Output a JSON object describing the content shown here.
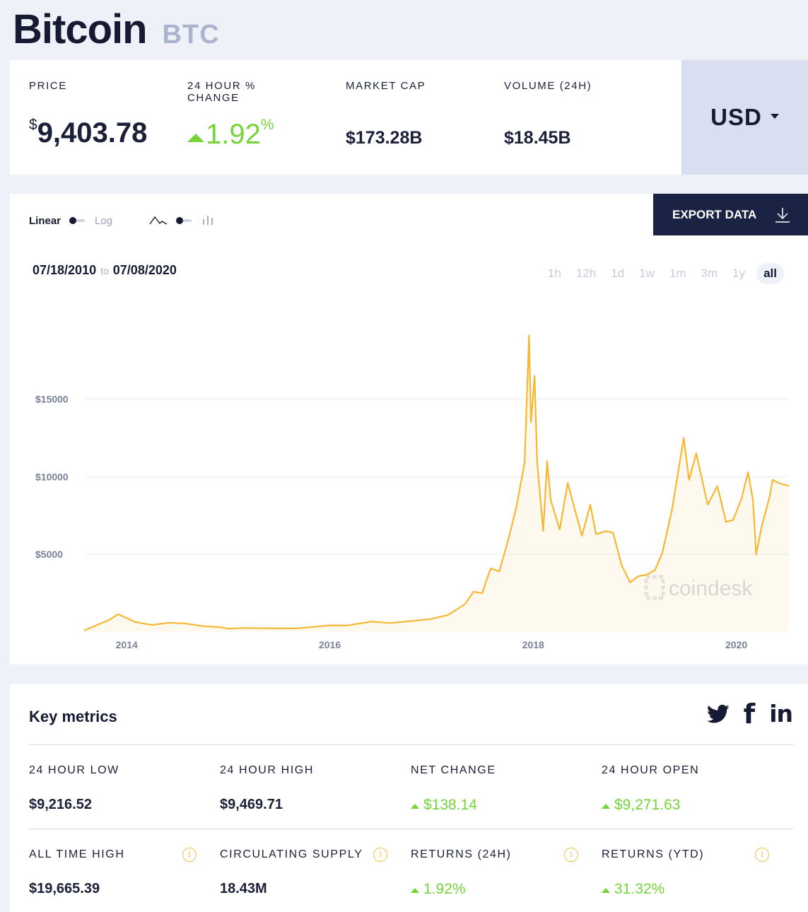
{
  "header": {
    "name": "Bitcoin",
    "symbol": "BTC"
  },
  "stats": {
    "price": {
      "label": "PRICE",
      "currency_symbol": "$",
      "value": "9,403.78"
    },
    "change": {
      "label_line1": "24 HOUR %",
      "label_line2": "CHANGE",
      "value": "1.92",
      "unit": "%",
      "direction": "up"
    },
    "market_cap": {
      "label": "MARKET CAP",
      "value": "$173.28B"
    },
    "volume": {
      "label": "VOLUME (24H)",
      "value": "$18.45B"
    },
    "currency": "USD"
  },
  "chart_controls": {
    "scale_left": "Linear",
    "scale_right": "Log",
    "line_icon": "line-chart-icon",
    "bar_icon": "candlestick-icon",
    "export_label": "EXPORT DATA",
    "date_from": "07/18/2010",
    "date_to_word": "to",
    "date_to": "07/08/2020",
    "ranges": [
      "1h",
      "12h",
      "1d",
      "1w",
      "1m",
      "3m",
      "1y",
      "all"
    ],
    "active_range": "all",
    "watermark": "coindesk"
  },
  "chart_data": {
    "type": "area",
    "xlabel": "",
    "ylabel": "",
    "x_ticks": [
      "2014",
      "2016",
      "2018",
      "2020"
    ],
    "y_ticks": [
      "$5000",
      "$10000",
      "$15000"
    ],
    "ylim": [
      0,
      19800
    ],
    "grid": true,
    "color": "#f7b731",
    "x": [
      "2013-08",
      "2013-11",
      "2013-12",
      "2014-02",
      "2014-04",
      "2014-06",
      "2014-08",
      "2014-10",
      "2014-12",
      "2015-01",
      "2015-03",
      "2015-06",
      "2015-09",
      "2015-11",
      "2016-01",
      "2016-03",
      "2016-06",
      "2016-08",
      "2016-11",
      "2017-01",
      "2017-03",
      "2017-05",
      "2017-06",
      "2017-07",
      "2017-08",
      "2017-09",
      "2017-10",
      "2017-11",
      "2017-12-01",
      "2017-12-17",
      "2017-12-24",
      "2018-01-06",
      "2018-01-15",
      "2018-02-06",
      "2018-02-20",
      "2018-03-05",
      "2018-04-06",
      "2018-05-05",
      "2018-06-25",
      "2018-07-25",
      "2018-08-15",
      "2018-09-20",
      "2018-10-15",
      "2018-11-15",
      "2018-12-15",
      "2019-01-15",
      "2019-02-15",
      "2019-03-15",
      "2019-04-10",
      "2019-05-15",
      "2019-06-26",
      "2019-07-15",
      "2019-08-10",
      "2019-09-20",
      "2019-10-25",
      "2019-11-25",
      "2019-12-20",
      "2020-01-20",
      "2020-02-12",
      "2020-03-01",
      "2020-03-12",
      "2020-04-01",
      "2020-05-01",
      "2020-05-10",
      "2020-06-01",
      "2020-07-08"
    ],
    "values": [
      100,
      800,
      1150,
      650,
      450,
      600,
      550,
      380,
      320,
      220,
      260,
      240,
      230,
      330,
      430,
      420,
      680,
      580,
      730,
      850,
      1100,
      1800,
      2600,
      2500,
      4100,
      3900,
      5800,
      8000,
      10900,
      19100,
      13500,
      16500,
      11000,
      6500,
      11000,
      8500,
      6600,
      9600,
      6200,
      8200,
      6300,
      6500,
      6400,
      4300,
      3200,
      3600,
      3700,
      4000,
      5100,
      7900,
      12500,
      9800,
      11500,
      8200,
      9400,
      7100,
      7200,
      8600,
      10300,
      8500,
      5000,
      6800,
      8800,
      9800,
      9600,
      9400
    ]
  },
  "metrics": {
    "title": "Key metrics",
    "social": [
      "twitter-icon",
      "facebook-icon",
      "linkedin-icon"
    ],
    "facebook_glyph": "f",
    "linkedin_glyph": "in",
    "info_glyph": "i",
    "row1": [
      {
        "label": "24 HOUR LOW",
        "value": "$9,216.52",
        "up": false
      },
      {
        "label": "24 HOUR HIGH",
        "value": "$9,469.71",
        "up": false
      },
      {
        "label": "NET CHANGE",
        "value": "$138.14",
        "up": true
      },
      {
        "label": "24 HOUR OPEN",
        "value": "$9,271.63",
        "up": true
      }
    ],
    "row2": [
      {
        "label": "ALL TIME HIGH",
        "value": "$19,665.39",
        "up": false
      },
      {
        "label": "CIRCULATING SUPPLY",
        "value": "18.43M",
        "up": false
      },
      {
        "label": "RETURNS (24H)",
        "value": "1.92%",
        "up": true
      },
      {
        "label": "RETURNS (YTD)",
        "value": "31.32%",
        "up": true
      }
    ]
  },
  "colors": {
    "accent": "#f7b731",
    "positive": "#74d43a",
    "dark": "#161b33",
    "panel": "#d9def0"
  }
}
